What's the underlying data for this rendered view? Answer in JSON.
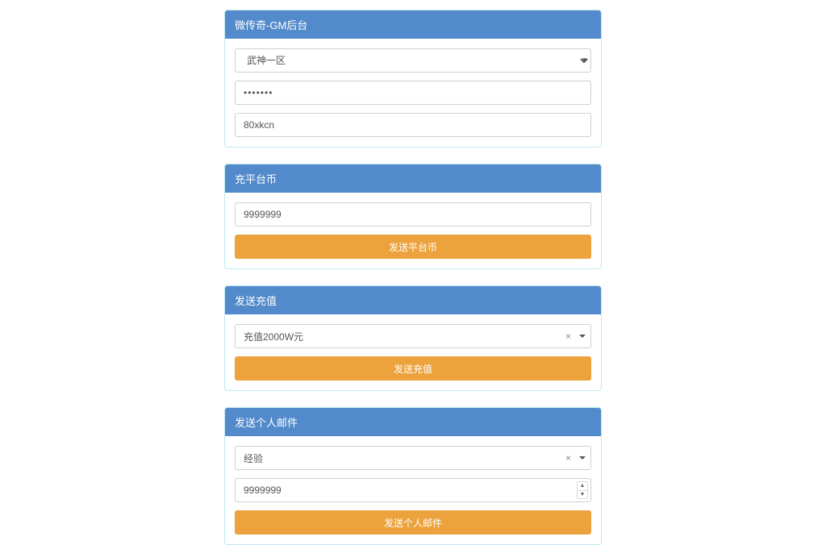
{
  "panel1": {
    "title": "微传奇-GM后台",
    "server_selected": "武神一区",
    "password_value": "•••••••",
    "code_value": "80xkcn"
  },
  "panel2": {
    "title": "充平台币",
    "amount_value": "9999999",
    "submit_label": "发送平台币"
  },
  "panel3": {
    "title": "发送充值",
    "combo_value": "充值2000W元",
    "clear_glyph": "×",
    "submit_label": "发送充值"
  },
  "panel4": {
    "title": "发送个人邮件",
    "combo_value": "经验",
    "clear_glyph": "×",
    "amount_value": "9999999",
    "submit_label": "发送个人邮件"
  }
}
